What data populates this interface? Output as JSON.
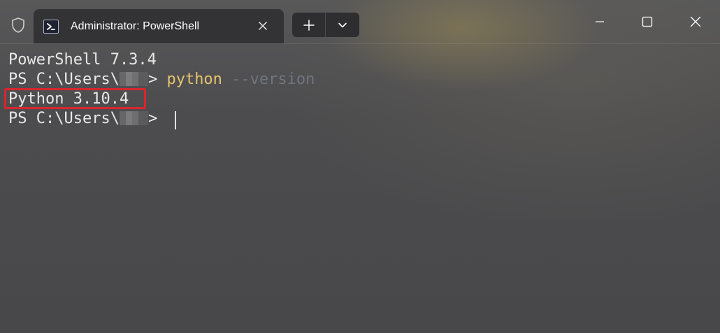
{
  "window": {
    "tab_title": "Administrator: PowerShell",
    "icons": {
      "shield": "shield-icon",
      "tab": "powershell-icon",
      "close_tab": "close-icon",
      "new_tab": "plus-icon",
      "dropdown": "chevron-down-icon",
      "minimize": "minimize-icon",
      "maximize": "maximize-icon",
      "close": "close-icon"
    }
  },
  "terminal": {
    "version_line": "PowerShell 7.3.4",
    "prompt_prefix": "PS C:\\Users\\",
    "prompt_suffix": "> ",
    "command": "python",
    "argument": "--version",
    "output": "Python 3.10.4",
    "highlight_color": "#d8262d",
    "command_color": "#e6c36e",
    "argument_color": "#6f7480"
  }
}
